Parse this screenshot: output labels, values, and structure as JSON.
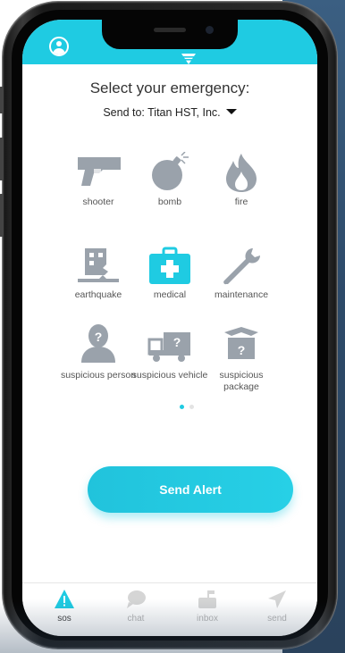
{
  "header": {
    "title": "Select your emergency:",
    "send_to_label": "Send to: Titan HST, Inc.",
    "accent_color": "#1fcbe2"
  },
  "emergencies": [
    {
      "icon": "gun-icon",
      "label": "shooter"
    },
    {
      "icon": "bomb-icon",
      "label": "bomb"
    },
    {
      "icon": "fire-icon",
      "label": "fire"
    },
    {
      "icon": "earthquake-icon",
      "label": "earthquake"
    },
    {
      "icon": "medical-icon",
      "label": "medical",
      "selected": true
    },
    {
      "icon": "wrench-icon",
      "label": "maintenance"
    },
    {
      "icon": "suspicious-person-icon",
      "label": "suspicious person"
    },
    {
      "icon": "suspicious-vehicle-icon",
      "label": "suspicious vehicle"
    },
    {
      "icon": "suspicious-package-icon",
      "label": "suspicious package"
    }
  ],
  "pager": {
    "pages": 2,
    "current": 1
  },
  "actions": {
    "send_alert_label": "Send Alert"
  },
  "tabs": [
    {
      "icon": "warning-icon",
      "label": "sos",
      "active": true
    },
    {
      "icon": "chat-bubble-icon",
      "label": "chat"
    },
    {
      "icon": "mailbox-icon",
      "label": "inbox"
    },
    {
      "icon": "paper-plane-icon",
      "label": "send"
    }
  ]
}
